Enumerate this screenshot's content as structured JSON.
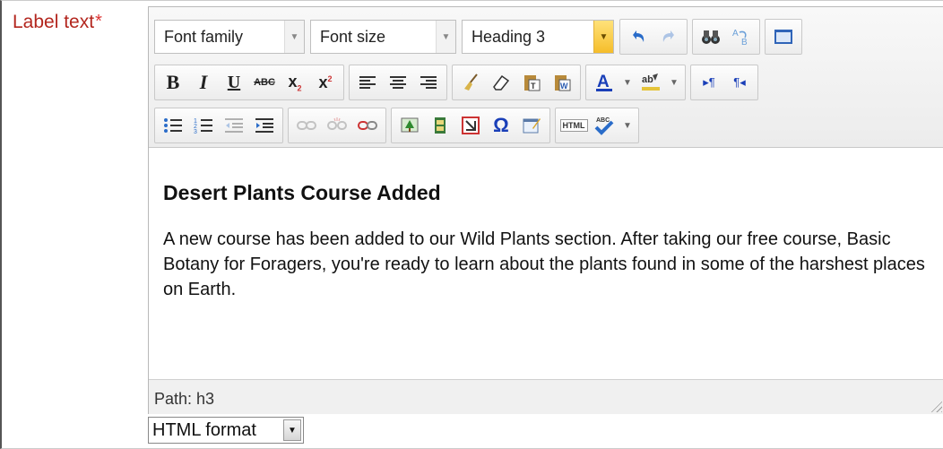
{
  "field": {
    "label": "Label text",
    "required_mark": "*"
  },
  "toolbar": {
    "font_family": "Font family",
    "font_size": "Font size",
    "block_format": "Heading 3",
    "html_label": "HTML",
    "abc_label": "ABC",
    "spell_label": "ABC"
  },
  "content": {
    "heading": "Desert Plants Course Added",
    "paragraph": "A new course has been added to our Wild Plants section. After taking our free course, Basic Botany for Foragers, you're ready to learn about the plants found in some of the harshest places on Earth."
  },
  "statusbar": {
    "path": "Path: h3"
  },
  "format": {
    "selected": "HTML format"
  },
  "colors": {
    "label_red": "#b3261e",
    "accent_yellow": "#f5bd2a",
    "text_a": "#1a3fb8"
  }
}
